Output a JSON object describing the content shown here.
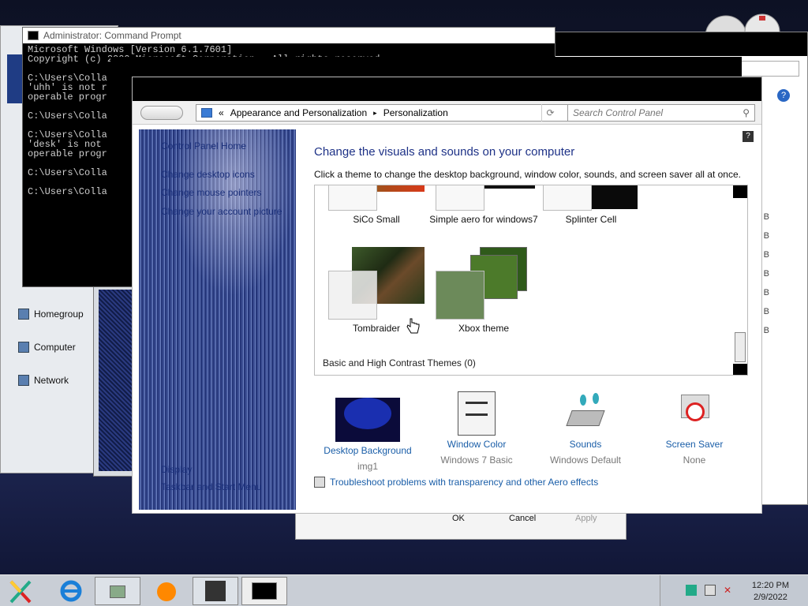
{
  "cmd": {
    "title": "Administrator: Command Prompt",
    "lines": [
      "Microsoft Windows [Version 6.1.7601]",
      "Copyright (c) 2009 Microsoft Corporation.  All rights reserved.",
      "",
      "C:\\Users\\Colla",
      "'uhh' is not r",
      "operable progr",
      "",
      "C:\\Users\\Colla",
      "",
      "C:\\Users\\Colla",
      "'desk' is not",
      "operable progr",
      "",
      "C:\\Users\\Colla",
      "",
      "C:\\Users\\Colla"
    ]
  },
  "explorer_nav": {
    "items": [
      {
        "label": "Homegroup"
      },
      {
        "label": "Computer"
      },
      {
        "label": "Network"
      }
    ]
  },
  "bg_right": {
    "help": "?",
    "b_list": [
      "B",
      "B",
      "B",
      "B",
      "B",
      "B",
      "B"
    ]
  },
  "address": {
    "prefix": "«",
    "crumb1": "Appearance and Personalization",
    "sep": "▸",
    "crumb2": "Personalization",
    "search_placeholder": "Search Control Panel"
  },
  "sidebar": {
    "links": [
      {
        "label": "Control Panel Home"
      },
      {
        "label": "Change desktop icons"
      },
      {
        "label": "Change mouse pointers"
      },
      {
        "label": "Change your account picture"
      }
    ],
    "see_also": [
      {
        "label": "Display"
      },
      {
        "label": "Taskbar and Start Menu"
      }
    ]
  },
  "main": {
    "heading": "Change the visuals and sounds on your computer",
    "subheading": "Click a theme to change the desktop background, window color, sounds, and screen saver all at once.",
    "help": "?"
  },
  "themes": [
    {
      "name": "SiCo Small"
    },
    {
      "name": "Simple aero for windows7"
    },
    {
      "name": "Splinter Cell"
    },
    {
      "name": "Tombraider"
    },
    {
      "name": "Xbox theme"
    }
  ],
  "basic_high_contrast": "Basic and High Contrast Themes (0)",
  "quick": [
    {
      "label": "Desktop Background",
      "value": "img1"
    },
    {
      "label": "Window Color",
      "value": "Windows 7 Basic"
    },
    {
      "label": "Sounds",
      "value": "Windows Default"
    },
    {
      "label": "Screen Saver",
      "value": "None"
    }
  ],
  "troubleshoot": "Troubleshoot problems with transparency and other Aero effects",
  "dialog_buttons": {
    "ok": "OK",
    "cancel": "Cancel",
    "apply": "Apply"
  },
  "clock": {
    "time": "12:20 PM",
    "date": "2/9/2022"
  },
  "colors": {
    "link": "#1a5ea8",
    "heading": "#1e3287",
    "taskbar": "#c9ced6"
  }
}
